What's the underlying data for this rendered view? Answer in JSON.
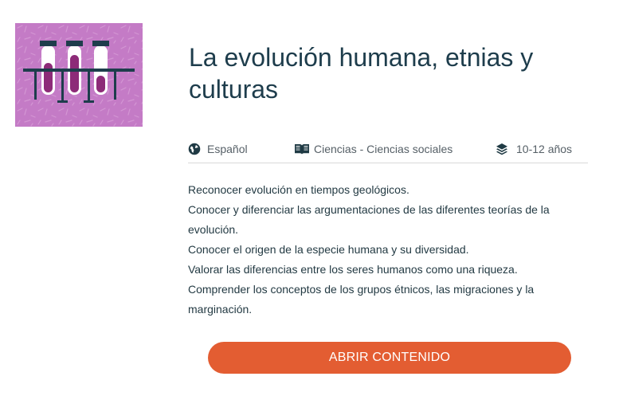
{
  "resource": {
    "title": "La evolución humana, etnias y culturas",
    "thumbnail_icon": "test-tubes-icon",
    "meta": {
      "language": {
        "icon": "globe-icon",
        "label": "Español"
      },
      "subject": {
        "icon": "open-book-icon",
        "label": "Ciencias - Ciencias sociales"
      },
      "age": {
        "icon": "layers-icon",
        "label": "10-12 años"
      }
    },
    "objectives": [
      "Reconocer evolución en tiempos geológicos.",
      "Conocer y diferenciar las argumentaciones de las diferentes teorías de la evolución.",
      "Conocer el origen de la especie humana y su diversidad.",
      "Valorar las diferencias entre los seres humanos como una riqueza.",
      "Comprender los conceptos de los grupos étnicos, las migraciones y la marginación."
    ],
    "open_button_label": "ABRIR CONTENIDO"
  },
  "colors": {
    "thumbnail_background": "#c47bc6",
    "tube_liquid": "#8d2b78",
    "accent_button": "#e35d32",
    "title_text": "#1e3d4c"
  }
}
